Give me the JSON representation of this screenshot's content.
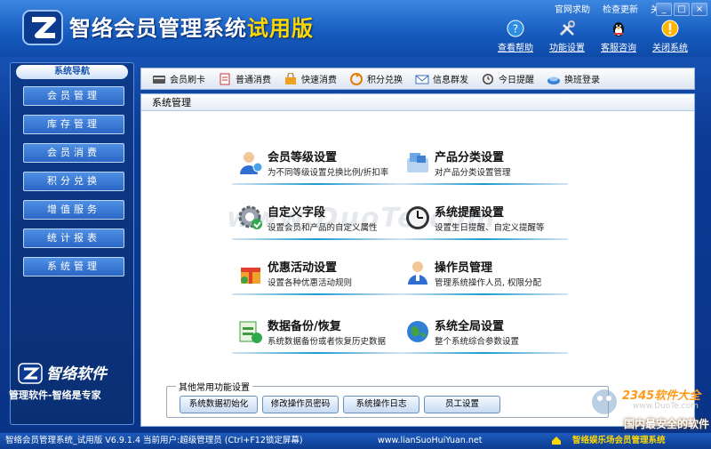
{
  "header": {
    "title_main": "智络会员管理系统",
    "title_trial": "试用版",
    "links": [
      "官网求助",
      "检查更新",
      "关于"
    ],
    "window_controls": [
      "_",
      "□",
      "×"
    ],
    "quick_tools": [
      {
        "label": "查看帮助",
        "icon": "help-icon"
      },
      {
        "label": "功能设置",
        "icon": "tools-icon"
      },
      {
        "label": "客服咨询",
        "icon": "qq-penguin-icon"
      },
      {
        "label": "关闭系统",
        "icon": "warning-icon"
      }
    ]
  },
  "sidebar": {
    "title": "系统导航",
    "items": [
      "会员管理",
      "库存管理",
      "会员消费",
      "积分兑换",
      "增值服务",
      "统计报表",
      "系统管理"
    ]
  },
  "brand": {
    "name": "智络软件",
    "slogan": "管理软件-智络是专家"
  },
  "toolbar": {
    "items": [
      {
        "label": "会员刷卡",
        "icon": "card-reader-icon"
      },
      {
        "label": "普通消费",
        "icon": "receipt-icon"
      },
      {
        "label": "快速消费",
        "icon": "shopping-bag-icon"
      },
      {
        "label": "积分兑换",
        "icon": "exchange-icon"
      },
      {
        "label": "信息群发",
        "icon": "mail-icon"
      },
      {
        "label": "今日提醒",
        "icon": "clock-icon"
      },
      {
        "label": "换班登录",
        "icon": "login-icon"
      }
    ]
  },
  "panel": {
    "title": "系统管理",
    "features": [
      {
        "title": "会员等级设置",
        "desc": "为不同等级设置兑换比例/折扣率",
        "icon": "member-level-icon"
      },
      {
        "title": "产品分类设置",
        "desc": "对产品分类设置管理",
        "icon": "product-category-icon"
      },
      {
        "title": "自定义字段",
        "desc": "设置会员和产品的自定义属性",
        "icon": "gear-icon"
      },
      {
        "title": "系统提醒设置",
        "desc": "设置生日提醒、自定义提醒等",
        "icon": "clock-icon"
      },
      {
        "title": "优惠活动设置",
        "desc": "设置各种优惠活动规则",
        "icon": "gift-icon"
      },
      {
        "title": "操作员管理",
        "desc": "管理系统操作人员, 权限分配",
        "icon": "operator-icon"
      },
      {
        "title": "数据备份/恢复",
        "desc": "系统数据备份或者恢复历史数据",
        "icon": "backup-icon"
      },
      {
        "title": "系统全局设置",
        "desc": "整个系统综合参数设置",
        "icon": "globe-icon"
      }
    ],
    "watermark": "www.DuoTe.com",
    "common": {
      "legend": "其他常用功能设置",
      "buttons": [
        "系统数据初始化",
        "修改操作员密码",
        "系统操作日志",
        "员工设置"
      ]
    }
  },
  "statusbar": {
    "left": "智络会员管理系统_试用版 V6.9.1.4 当前用户:超级管理员 (Ctrl+F12锁定屏幕)",
    "url": "www.lianSuoHuiYuan.net",
    "right": "智络娱乐场会员管理系统"
  },
  "site_mark": {
    "num": "2345软件大全",
    "url": "www.DuoTe.com",
    "tag": "国内最安全的软件站"
  },
  "colors": {
    "header": "#165bbd",
    "sidebar": "#0a2f74",
    "accent_yellow": "#ffd800",
    "panel_line": "#1a9bd0"
  }
}
